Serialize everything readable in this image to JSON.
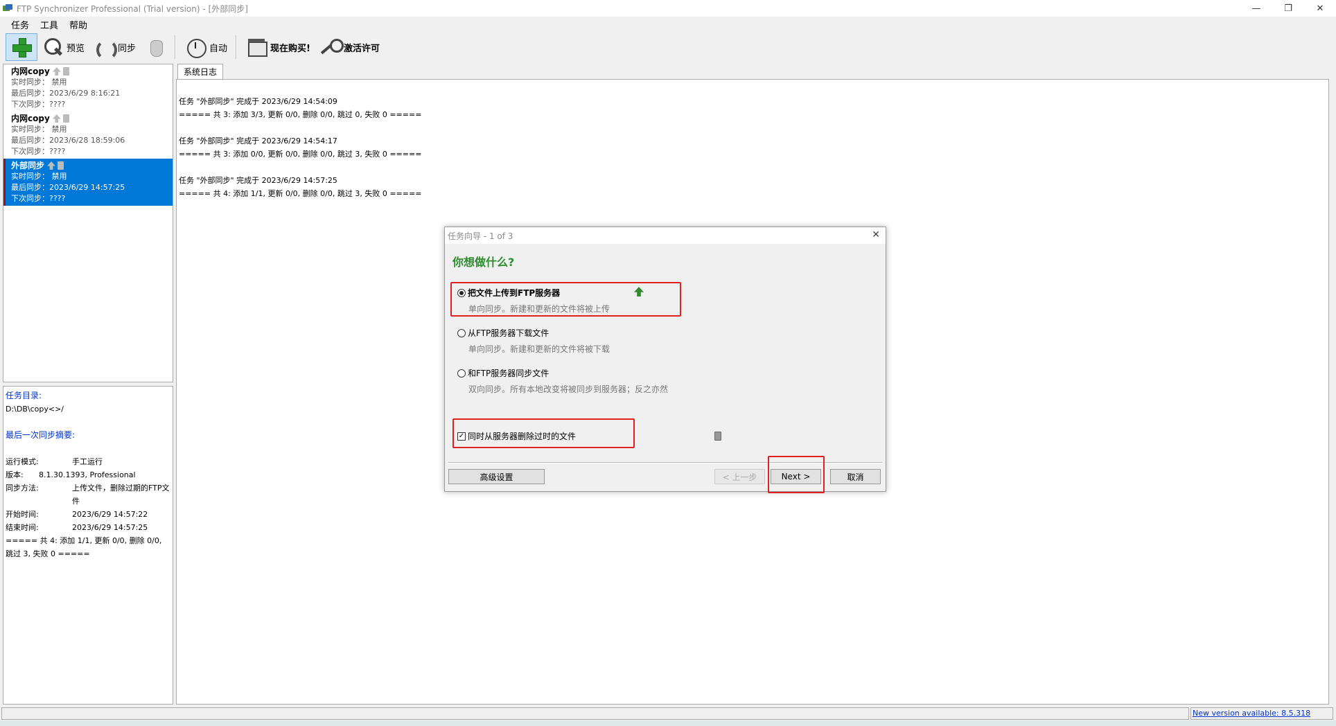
{
  "window": {
    "title": "FTP Synchronizer Professional (Trial version) - [外部同步]",
    "controls": [
      "—",
      "❐",
      "✕"
    ]
  },
  "menu": [
    "任务",
    "工具",
    "帮助"
  ],
  "toolbar": {
    "preview": "预览",
    "sync": "同步",
    "auto": "自动",
    "buy": "现在购买!",
    "activate": "激活许可"
  },
  "tasks": [
    {
      "name": "内网copy",
      "realtime": "实时同步： 禁用",
      "last": "最后同步：2023/6/29 8:16:21",
      "next": "下次同步：????"
    },
    {
      "name": "内网copy",
      "realtime": "实时同步： 禁用",
      "last": "最后同步：2023/6/28 18:59:06",
      "next": "下次同步：????"
    },
    {
      "name": "外部同步",
      "realtime": "实时同步： 禁用",
      "last": "最后同步：2023/6/29 14:57:25",
      "next": "下次同步：????"
    }
  ],
  "info": {
    "dir_header": "任务目录:",
    "dir_value": "D:\\DB\\copy<>/",
    "summary_header": "最后一次同步摘要:",
    "rows": [
      {
        "k": "运行模式:",
        "v": "手工运行"
      },
      {
        "k": "版本:",
        "v": "8.1.30.1393, Professional"
      },
      {
        "k": "同步方法:",
        "v": "上传文件，删除过期的FTP文件"
      },
      {
        "k": "开始时间:",
        "v": "2023/6/29 14:57:22"
      },
      {
        "k": "结束时间:",
        "v": "2023/6/29 14:57:25"
      }
    ],
    "result": "===== 共 4: 添加 1/1, 更新 0/0, 删除 0/0, 跳过 3, 失败 0 ====="
  },
  "log": {
    "tab": "系统日志",
    "entries": [
      {
        "line1": "任务 \"外部同步\" 完成于 2023/6/29 14:54:09",
        "line2": "===== 共 3: 添加 3/3, 更新 0/0, 删除 0/0, 跳过 0, 失败 0 ====="
      },
      {
        "line1": "任务 \"外部同步\" 完成于 2023/6/29 14:54:17",
        "line2": "===== 共 3: 添加 0/0, 更新 0/0, 删除 0/0, 跳过 3, 失败 0 ====="
      },
      {
        "line1": "任务 \"外部同步\" 完成于 2023/6/29 14:57:25",
        "line2": "===== 共 4: 添加 1/1, 更新 0/0, 删除 0/0, 跳过 3, 失败 0 ====="
      }
    ]
  },
  "status": {
    "new_version": "New version available: 8.5.318"
  },
  "dialog": {
    "title": "任务向导 - 1 of 3",
    "close": "✕",
    "heading": "你想做什么?",
    "options": [
      {
        "label": "把文件上传到FTP服务器",
        "desc": "单向同步。新建和更新的文件将被上传",
        "checked": true
      },
      {
        "label": "从FTP服务器下载文件",
        "desc": "单向同步。新建和更新的文件将被下载",
        "checked": false
      },
      {
        "label": "和FTP服务器同步文件",
        "desc": "双向同步。所有本地改变将被同步到服务器；反之亦然",
        "checked": false
      }
    ],
    "delete_checkbox": {
      "label": "同时从服务器删除过时的文件",
      "checked": true,
      "mark": "✓"
    },
    "buttons": {
      "advanced": "高级设置",
      "back": "< 上一步",
      "next": "Next >",
      "cancel": "取消"
    },
    "highlight_color": "#e02020"
  }
}
